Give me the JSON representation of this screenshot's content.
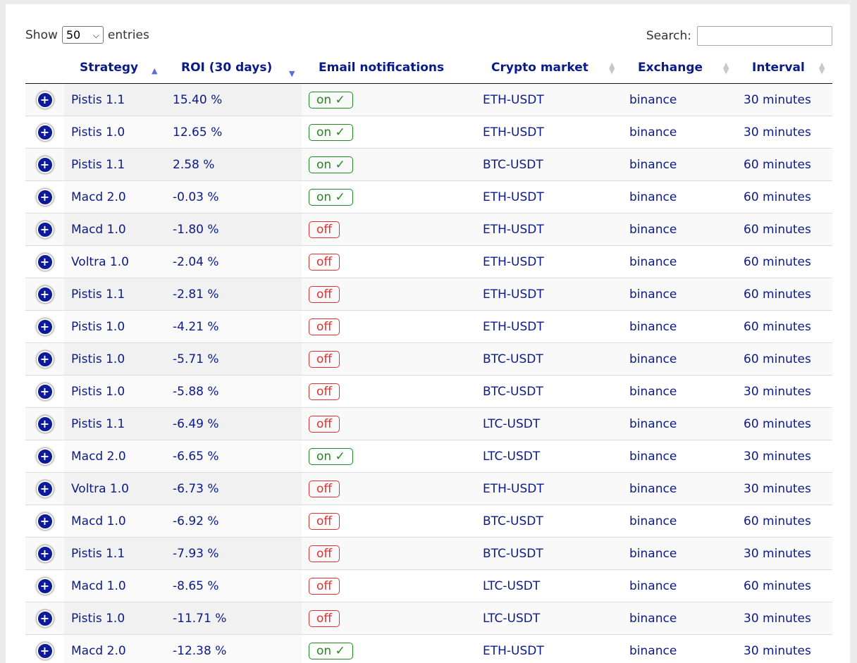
{
  "length": {
    "prefix": "Show",
    "value": "50",
    "suffix": "entries"
  },
  "search": {
    "label": "Search:",
    "value": ""
  },
  "columns": [
    {
      "label": "",
      "sort": "none"
    },
    {
      "label": "Strategy",
      "sort": "asc"
    },
    {
      "label": "ROI (30 days)",
      "sort": "desc"
    },
    {
      "label": "Email notifications",
      "sort": "none"
    },
    {
      "label": "Crypto market",
      "sort": "both"
    },
    {
      "label": "Exchange",
      "sort": "both"
    },
    {
      "label": "Interval",
      "sort": "both"
    }
  ],
  "rows": [
    {
      "strategy": "Pistis 1.1",
      "roi": "15.40 %",
      "email": "on ✓",
      "market": "ETH-USDT",
      "exchange": "binance",
      "interval": "30 minutes"
    },
    {
      "strategy": "Pistis 1.0",
      "roi": "12.65 %",
      "email": "on ✓",
      "market": "ETH-USDT",
      "exchange": "binance",
      "interval": "30 minutes"
    },
    {
      "strategy": "Pistis 1.1",
      "roi": "2.58 %",
      "email": "on ✓",
      "market": "BTC-USDT",
      "exchange": "binance",
      "interval": "60 minutes"
    },
    {
      "strategy": "Macd 2.0",
      "roi": "-0.03 %",
      "email": "on ✓",
      "market": "ETH-USDT",
      "exchange": "binance",
      "interval": "60 minutes"
    },
    {
      "strategy": "Macd 1.0",
      "roi": "-1.80 %",
      "email": "off",
      "market": "ETH-USDT",
      "exchange": "binance",
      "interval": "60 minutes"
    },
    {
      "strategy": "Voltra 1.0",
      "roi": "-2.04 %",
      "email": "off",
      "market": "ETH-USDT",
      "exchange": "binance",
      "interval": "60 minutes"
    },
    {
      "strategy": "Pistis 1.1",
      "roi": "-2.81 %",
      "email": "off",
      "market": "ETH-USDT",
      "exchange": "binance",
      "interval": "60 minutes"
    },
    {
      "strategy": "Pistis 1.0",
      "roi": "-4.21 %",
      "email": "off",
      "market": "ETH-USDT",
      "exchange": "binance",
      "interval": "60 minutes"
    },
    {
      "strategy": "Pistis 1.0",
      "roi": "-5.71 %",
      "email": "off",
      "market": "BTC-USDT",
      "exchange": "binance",
      "interval": "60 minutes"
    },
    {
      "strategy": "Pistis 1.0",
      "roi": "-5.88 %",
      "email": "off",
      "market": "BTC-USDT",
      "exchange": "binance",
      "interval": "30 minutes"
    },
    {
      "strategy": "Pistis 1.1",
      "roi": "-6.49 %",
      "email": "off",
      "market": "LTC-USDT",
      "exchange": "binance",
      "interval": "60 minutes"
    },
    {
      "strategy": "Macd 2.0",
      "roi": "-6.65 %",
      "email": "on ✓",
      "market": "LTC-USDT",
      "exchange": "binance",
      "interval": "30 minutes"
    },
    {
      "strategy": "Voltra 1.0",
      "roi": "-6.73 %",
      "email": "off",
      "market": "ETH-USDT",
      "exchange": "binance",
      "interval": "30 minutes"
    },
    {
      "strategy": "Macd 1.0",
      "roi": "-6.92 %",
      "email": "off",
      "market": "BTC-USDT",
      "exchange": "binance",
      "interval": "60 minutes"
    },
    {
      "strategy": "Pistis 1.1",
      "roi": "-7.93 %",
      "email": "off",
      "market": "BTC-USDT",
      "exchange": "binance",
      "interval": "30 minutes"
    },
    {
      "strategy": "Macd 1.0",
      "roi": "-8.65 %",
      "email": "off",
      "market": "LTC-USDT",
      "exchange": "binance",
      "interval": "60 minutes"
    },
    {
      "strategy": "Pistis 1.0",
      "roi": "-11.71 %",
      "email": "off",
      "market": "LTC-USDT",
      "exchange": "binance",
      "interval": "30 minutes"
    },
    {
      "strategy": "Macd 2.0",
      "roi": "-12.38 %",
      "email": "on ✓",
      "market": "ETH-USDT",
      "exchange": "binance",
      "interval": "30 minutes"
    }
  ],
  "colors": {
    "link": "#0b1a8a",
    "on": "#1e8a1e",
    "off": "#e03030",
    "plus": "#0c1a9a"
  }
}
